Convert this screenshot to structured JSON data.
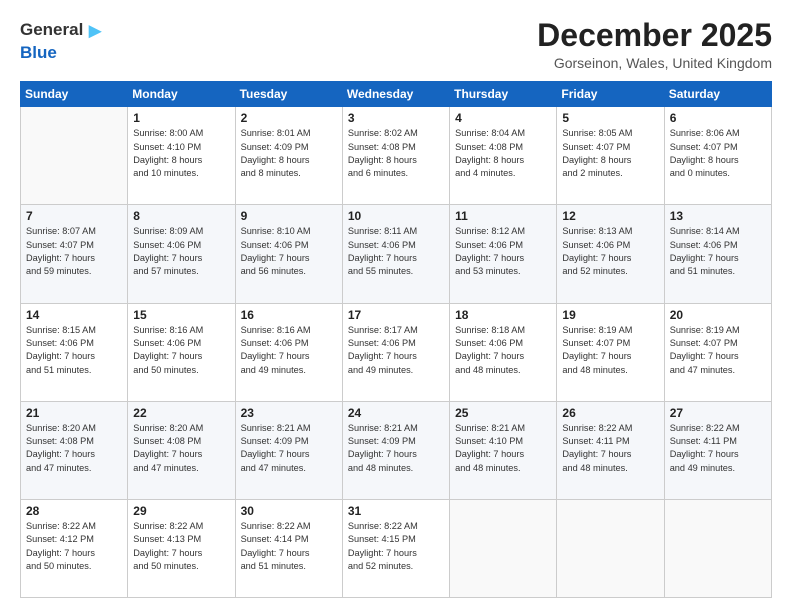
{
  "logo": {
    "line1": "General",
    "line2": "Blue",
    "arrow_color": "#4fc3f7"
  },
  "title": "December 2025",
  "location": "Gorseinon, Wales, United Kingdom",
  "weekdays": [
    "Sunday",
    "Monday",
    "Tuesday",
    "Wednesday",
    "Thursday",
    "Friday",
    "Saturday"
  ],
  "weeks": [
    [
      {
        "day": "",
        "info": ""
      },
      {
        "day": "1",
        "info": "Sunrise: 8:00 AM\nSunset: 4:10 PM\nDaylight: 8 hours\nand 10 minutes."
      },
      {
        "day": "2",
        "info": "Sunrise: 8:01 AM\nSunset: 4:09 PM\nDaylight: 8 hours\nand 8 minutes."
      },
      {
        "day": "3",
        "info": "Sunrise: 8:02 AM\nSunset: 4:08 PM\nDaylight: 8 hours\nand 6 minutes."
      },
      {
        "day": "4",
        "info": "Sunrise: 8:04 AM\nSunset: 4:08 PM\nDaylight: 8 hours\nand 4 minutes."
      },
      {
        "day": "5",
        "info": "Sunrise: 8:05 AM\nSunset: 4:07 PM\nDaylight: 8 hours\nand 2 minutes."
      },
      {
        "day": "6",
        "info": "Sunrise: 8:06 AM\nSunset: 4:07 PM\nDaylight: 8 hours\nand 0 minutes."
      }
    ],
    [
      {
        "day": "7",
        "info": "Sunrise: 8:07 AM\nSunset: 4:07 PM\nDaylight: 7 hours\nand 59 minutes."
      },
      {
        "day": "8",
        "info": "Sunrise: 8:09 AM\nSunset: 4:06 PM\nDaylight: 7 hours\nand 57 minutes."
      },
      {
        "day": "9",
        "info": "Sunrise: 8:10 AM\nSunset: 4:06 PM\nDaylight: 7 hours\nand 56 minutes."
      },
      {
        "day": "10",
        "info": "Sunrise: 8:11 AM\nSunset: 4:06 PM\nDaylight: 7 hours\nand 55 minutes."
      },
      {
        "day": "11",
        "info": "Sunrise: 8:12 AM\nSunset: 4:06 PM\nDaylight: 7 hours\nand 53 minutes."
      },
      {
        "day": "12",
        "info": "Sunrise: 8:13 AM\nSunset: 4:06 PM\nDaylight: 7 hours\nand 52 minutes."
      },
      {
        "day": "13",
        "info": "Sunrise: 8:14 AM\nSunset: 4:06 PM\nDaylight: 7 hours\nand 51 minutes."
      }
    ],
    [
      {
        "day": "14",
        "info": "Sunrise: 8:15 AM\nSunset: 4:06 PM\nDaylight: 7 hours\nand 51 minutes."
      },
      {
        "day": "15",
        "info": "Sunrise: 8:16 AM\nSunset: 4:06 PM\nDaylight: 7 hours\nand 50 minutes."
      },
      {
        "day": "16",
        "info": "Sunrise: 8:16 AM\nSunset: 4:06 PM\nDaylight: 7 hours\nand 49 minutes."
      },
      {
        "day": "17",
        "info": "Sunrise: 8:17 AM\nSunset: 4:06 PM\nDaylight: 7 hours\nand 49 minutes."
      },
      {
        "day": "18",
        "info": "Sunrise: 8:18 AM\nSunset: 4:06 PM\nDaylight: 7 hours\nand 48 minutes."
      },
      {
        "day": "19",
        "info": "Sunrise: 8:19 AM\nSunset: 4:07 PM\nDaylight: 7 hours\nand 48 minutes."
      },
      {
        "day": "20",
        "info": "Sunrise: 8:19 AM\nSunset: 4:07 PM\nDaylight: 7 hours\nand 47 minutes."
      }
    ],
    [
      {
        "day": "21",
        "info": "Sunrise: 8:20 AM\nSunset: 4:08 PM\nDaylight: 7 hours\nand 47 minutes."
      },
      {
        "day": "22",
        "info": "Sunrise: 8:20 AM\nSunset: 4:08 PM\nDaylight: 7 hours\nand 47 minutes."
      },
      {
        "day": "23",
        "info": "Sunrise: 8:21 AM\nSunset: 4:09 PM\nDaylight: 7 hours\nand 47 minutes."
      },
      {
        "day": "24",
        "info": "Sunrise: 8:21 AM\nSunset: 4:09 PM\nDaylight: 7 hours\nand 48 minutes."
      },
      {
        "day": "25",
        "info": "Sunrise: 8:21 AM\nSunset: 4:10 PM\nDaylight: 7 hours\nand 48 minutes."
      },
      {
        "day": "26",
        "info": "Sunrise: 8:22 AM\nSunset: 4:11 PM\nDaylight: 7 hours\nand 48 minutes."
      },
      {
        "day": "27",
        "info": "Sunrise: 8:22 AM\nSunset: 4:11 PM\nDaylight: 7 hours\nand 49 minutes."
      }
    ],
    [
      {
        "day": "28",
        "info": "Sunrise: 8:22 AM\nSunset: 4:12 PM\nDaylight: 7 hours\nand 50 minutes."
      },
      {
        "day": "29",
        "info": "Sunrise: 8:22 AM\nSunset: 4:13 PM\nDaylight: 7 hours\nand 50 minutes."
      },
      {
        "day": "30",
        "info": "Sunrise: 8:22 AM\nSunset: 4:14 PM\nDaylight: 7 hours\nand 51 minutes."
      },
      {
        "day": "31",
        "info": "Sunrise: 8:22 AM\nSunset: 4:15 PM\nDaylight: 7 hours\nand 52 minutes."
      },
      {
        "day": "",
        "info": ""
      },
      {
        "day": "",
        "info": ""
      },
      {
        "day": "",
        "info": ""
      }
    ]
  ]
}
